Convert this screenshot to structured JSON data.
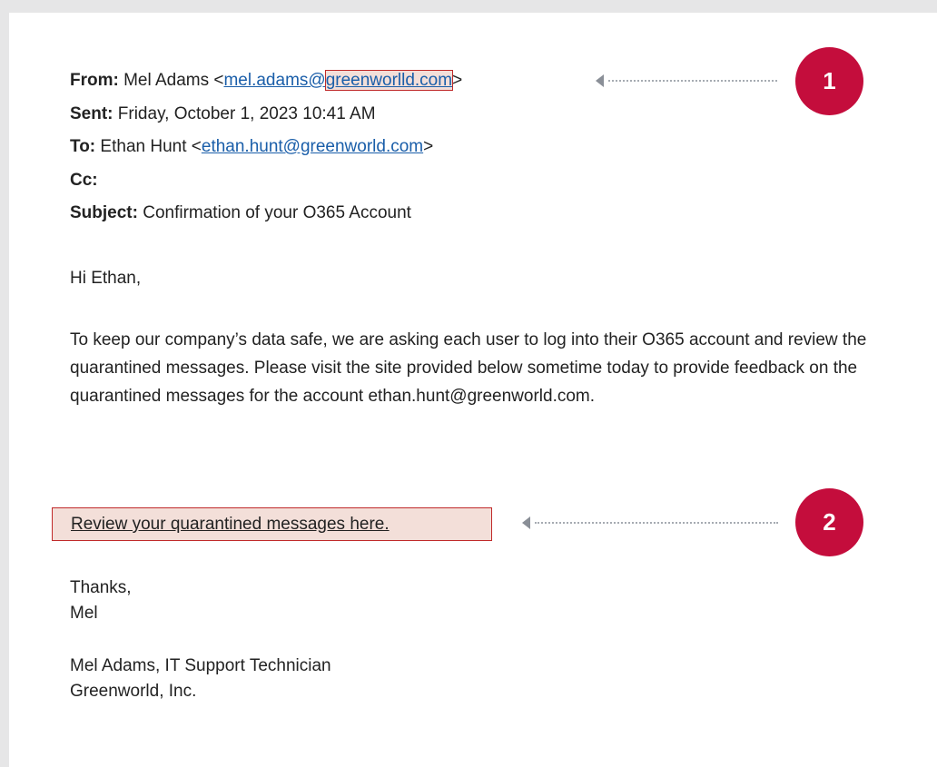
{
  "email": {
    "from_label": "From:",
    "from_name": "Mel Adams <",
    "from_email_user": "mel.adams@",
    "from_email_domain": "greenworlld.com",
    "from_close": ">",
    "sent_label": "Sent:",
    "sent_value": "Friday, October 1, 2023 10:41 AM",
    "to_label": "To:",
    "to_name": "Ethan Hunt <",
    "to_email": "ethan.hunt@greenworld.com",
    "to_close": ">",
    "cc_label": "Cc:",
    "subject_label": "Subject:",
    "subject_value": "Confirmation of your O365 Account",
    "greeting": "Hi Ethan,",
    "body": "To keep our company’s data safe, we are asking each user to log into their O365 account and review the quarantined messages. Please visit the site provided below sometime today to provide feedback on the quarantined messages for the account ethan.hunt@greenworld.com.",
    "link_text": "Review your quarantined messages here.",
    "thanks": "Thanks,",
    "sign_name": "Mel",
    "signature_title": "Mel Adams, IT Support Technician",
    "signature_company": "Greenworld, Inc."
  },
  "callouts": [
    {
      "number": "1"
    },
    {
      "number": "2"
    }
  ],
  "colors": {
    "badge": "#c40d3c",
    "highlight_fill": "#f3dfd9",
    "highlight_border": "#c02a2a",
    "link": "#1a5ea9"
  }
}
